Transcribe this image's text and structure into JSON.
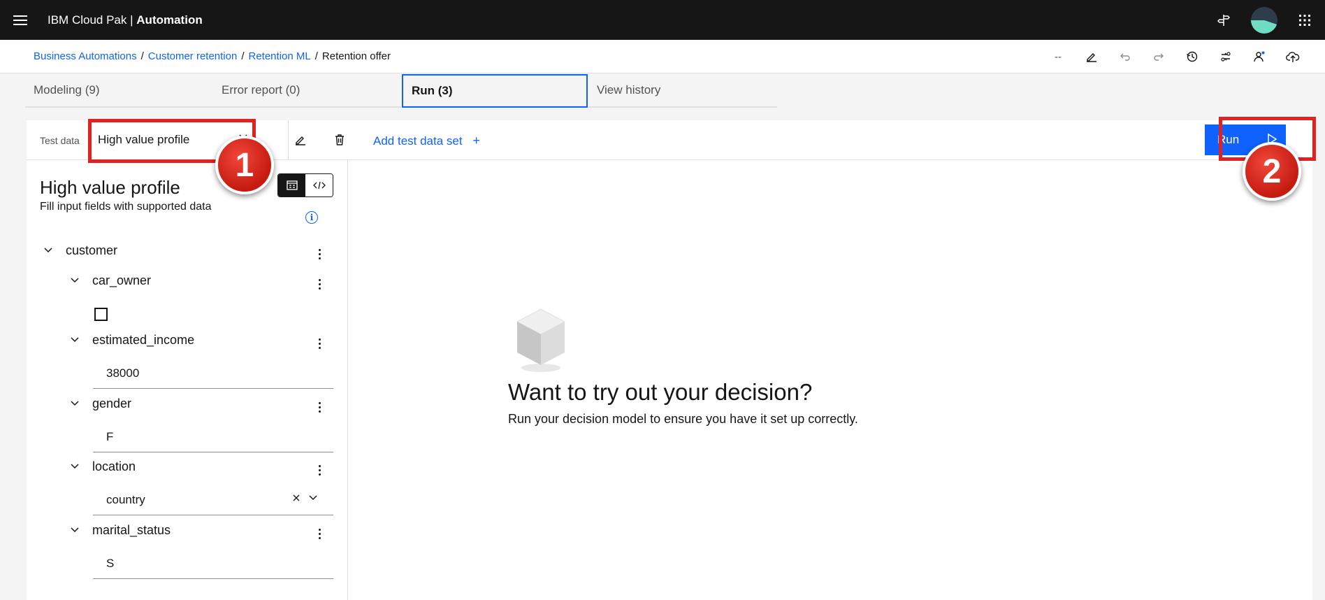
{
  "header": {
    "brand_prefix": "IBM Cloud Pak",
    "brand_separator": "|",
    "brand_product": "Automation"
  },
  "breadcrumb": {
    "items": [
      "Business Automations",
      "Customer retention",
      "Retention ML"
    ],
    "current": "Retention offer",
    "separator": "/"
  },
  "toolbar_status": "--",
  "tabs": [
    {
      "label": "Modeling (9)"
    },
    {
      "label": "Error report (0)"
    },
    {
      "label": "Run (3)",
      "active": true
    },
    {
      "label": "View history"
    }
  ],
  "run_panel": {
    "test_data_label": "Test data",
    "selected_test_data": "High value profile",
    "add_test_data_set": "Add test data set",
    "run_label": "Run"
  },
  "annotations": {
    "badge1": "1",
    "badge2": "2"
  },
  "input_panel": {
    "title": "High value profile",
    "subtitle": "Fill input fields with supported data",
    "root": "customer",
    "fields": [
      {
        "name": "car_owner",
        "type": "checkbox",
        "checked": false
      },
      {
        "name": "estimated_income",
        "value": "38000"
      },
      {
        "name": "gender",
        "value": "F"
      },
      {
        "name": "location",
        "value": "country"
      },
      {
        "name": "marital_status",
        "value": "S"
      }
    ]
  },
  "empty_state": {
    "title": "Want to try out your decision?",
    "subtitle": "Run your decision model to ensure you have it set up correctly."
  },
  "colors": {
    "accent": "#0f62fe",
    "header_bg": "#161616",
    "highlight": "#e02222"
  }
}
